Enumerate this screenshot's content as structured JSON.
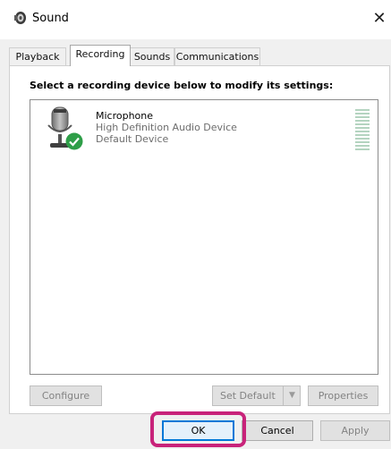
{
  "window": {
    "title": "Sound",
    "close_glyph": "✕"
  },
  "tabs": [
    {
      "label": "Playback",
      "active": false
    },
    {
      "label": "Recording",
      "active": true
    },
    {
      "label": "Sounds",
      "active": false
    },
    {
      "label": "Communications",
      "active": false
    }
  ],
  "panel": {
    "instruction": "Select a recording device below to modify its settings:",
    "device": {
      "name": "Microphone",
      "description": "High Definition Audio Device",
      "status": "Default Device",
      "icon": "microphone-icon",
      "badge": "check-icon",
      "level": 0
    }
  },
  "buttons": {
    "configure": {
      "label": "Configure",
      "enabled": false
    },
    "set_default": {
      "label": "Set Default",
      "enabled": false
    },
    "properties": {
      "label": "Properties",
      "enabled": false
    }
  },
  "footer": {
    "ok": "OK",
    "cancel": "Cancel",
    "apply": "Apply"
  },
  "colors": {
    "accent": "#0078d7",
    "highlight": "#c8237a",
    "check_green": "#2e9e48"
  }
}
